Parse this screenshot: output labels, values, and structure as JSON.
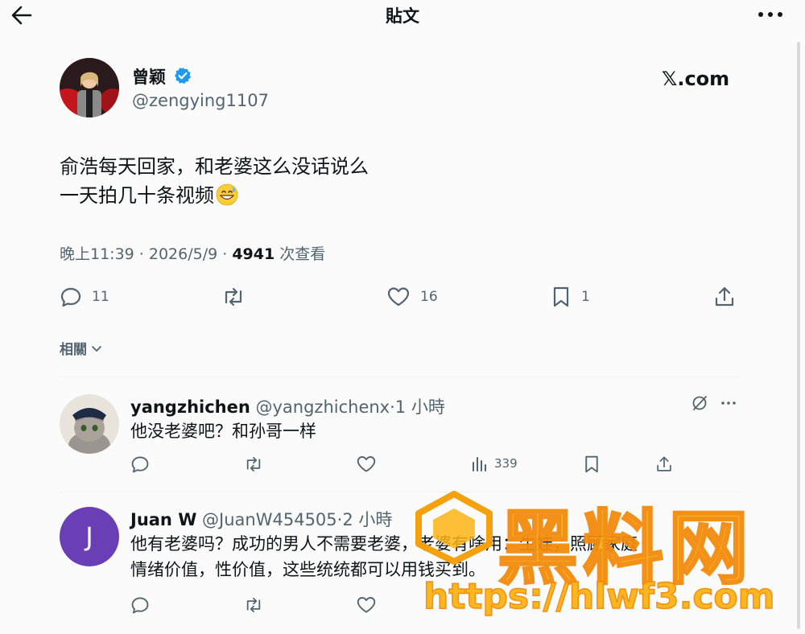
{
  "header": {
    "title": "貼文"
  },
  "author": {
    "name": "曾颖",
    "handle": "@zengying1107",
    "brand": "𝕏.com"
  },
  "tweet": {
    "lines": [
      "俞浩每天回家，和老婆这么没话说么",
      "一天拍几十条视频"
    ],
    "emoji": "grinning-face-with-sweat",
    "time": "晚上11:39 · 2026/5/9 · ",
    "views": "4941",
    "views_label": " 次查看"
  },
  "actions": {
    "replies": "11",
    "likes": "16",
    "bookmarks": "1"
  },
  "related": {
    "label": "相關"
  },
  "replies": [
    {
      "name": "yangzhichen",
      "handle": " @yangzhichenx",
      "time": "·1 小時",
      "text": [
        "他没老婆吧？和孙哥一样"
      ],
      "views": "339"
    },
    {
      "name": "Juan W",
      "handle": " @JuanW454505",
      "time": "·2 小時",
      "avatar_letter": "J",
      "text": [
        "他有老婆吗？成功的男人不需要老婆，老婆有啥用：生娃，照顾家庭",
        "情绪价值，性价值，这些统统都可以用钱买到。"
      ]
    }
  ],
  "watermark": {
    "brand": "黑料网",
    "url": "https://hlwf3.com"
  },
  "colors": {
    "text": "#0f1419",
    "secondary": "#536471",
    "verified": "#1d9bf0",
    "avatar_purple": "#6a3fb5",
    "watermark": "#fbb414"
  }
}
